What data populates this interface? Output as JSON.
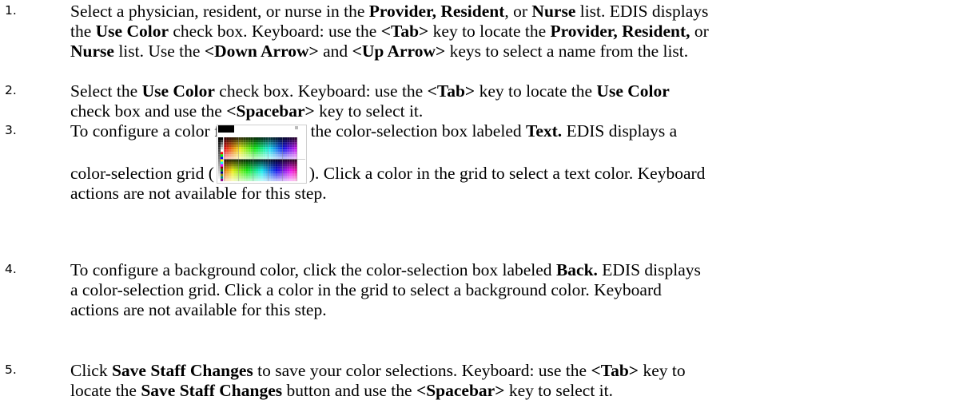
{
  "steps": [
    {
      "number": "1.",
      "lines": [
        [
          "Select a physician, resident, or nurse in the ",
          {
            "b": "Provider, Resident"
          },
          ", or ",
          {
            "b": "Nurse"
          },
          " list. EDIS displays"
        ],
        [
          "the ",
          {
            "b": "Use Color"
          },
          " check box. Keyboard: use the ",
          {
            "b": "<Tab>"
          },
          " key to locate the ",
          {
            "b": "Provider, Resident,"
          },
          " or"
        ],
        [
          {
            "b": "Nurse"
          },
          " list. Use the ",
          {
            "b": "<Down Arrow>"
          },
          " and ",
          {
            "b": "<Up Arrow>"
          },
          " keys to select a name from the list."
        ]
      ]
    },
    {
      "number": "2.",
      "lines": [
        [
          "Select the ",
          {
            "b": "Use Color"
          },
          " check box. Keyboard: use the ",
          {
            "b": "<Tab>"
          },
          " key to locate the ",
          {
            "b": "Use Color"
          }
        ],
        [
          "check box and use the ",
          {
            "b": "<Spacebar>"
          },
          " key to select it."
        ]
      ]
    },
    {
      "number": "3.",
      "lines": [
        [
          "To configure a color for text, click the color-selection box labeled ",
          {
            "b": "Text."
          },
          " EDIS displays a"
        ]
      ],
      "grid_line_before": "color-selection grid (",
      "grid_line_after": "). Click a color in the grid to select a text color. Keyboard",
      "tail_lines": [
        [
          "actions are not available for this step."
        ]
      ]
    },
    {
      "number": "4.",
      "lines": [
        [
          "To configure a background color, click the color-selection box labeled ",
          {
            "b": "Back."
          },
          " EDIS displays"
        ],
        [
          "a color-selection grid. Click a color in the grid to select a background color. Keyboard"
        ],
        [
          "actions are not available for this step."
        ]
      ]
    },
    {
      "number": "5.",
      "lines": [
        [
          "Click ",
          {
            "b": "Save Staff Changes"
          },
          " to save your color selections. Keyboard: use the ",
          {
            "b": "<Tab>"
          },
          " key to"
        ],
        [
          "locate the ",
          {
            "b": "Save Staff Changes"
          },
          " button and use the ",
          {
            "b": "<Spacebar>"
          },
          " key to select it."
        ]
      ]
    }
  ],
  "icons": {
    "color_grid": "color-grid-icon"
  }
}
